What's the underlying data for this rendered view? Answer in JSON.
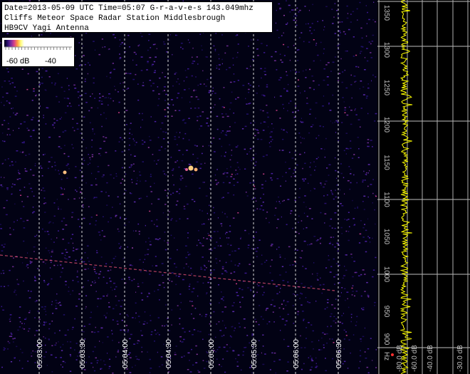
{
  "info": {
    "line1": "Date=2013-05-09 UTC Time=05:07  G-r-a-v-e-s 143.049mhz",
    "line2": "Cliffs Meteor Space Radar Station Middlesbrough",
    "line3": "HB9CV Yagi Antenna"
  },
  "scale": {
    "low": "-60 dB",
    "high": "-40"
  },
  "time_labels": [
    "05:03:00",
    "05:03:30",
    "05:04:00",
    "05:04:30",
    "05:05:00",
    "05:05:30",
    "05:06:00",
    "05:06:30"
  ],
  "freq_labels": [
    "1350",
    "1300",
    "1250",
    "1200",
    "1150",
    "1100",
    "1050",
    "1000",
    "950",
    "900",
    "Hz"
  ],
  "db_labels": [
    "-80.0 dB",
    "-60.0 dB",
    "-40.0 dB",
    "-30.0 dB"
  ],
  "colors": {
    "background": "#000000",
    "noise": "#2a1070",
    "signal": "#ff9a40",
    "spectrum": "#ffff00",
    "grid": "#c0c0c0"
  }
}
